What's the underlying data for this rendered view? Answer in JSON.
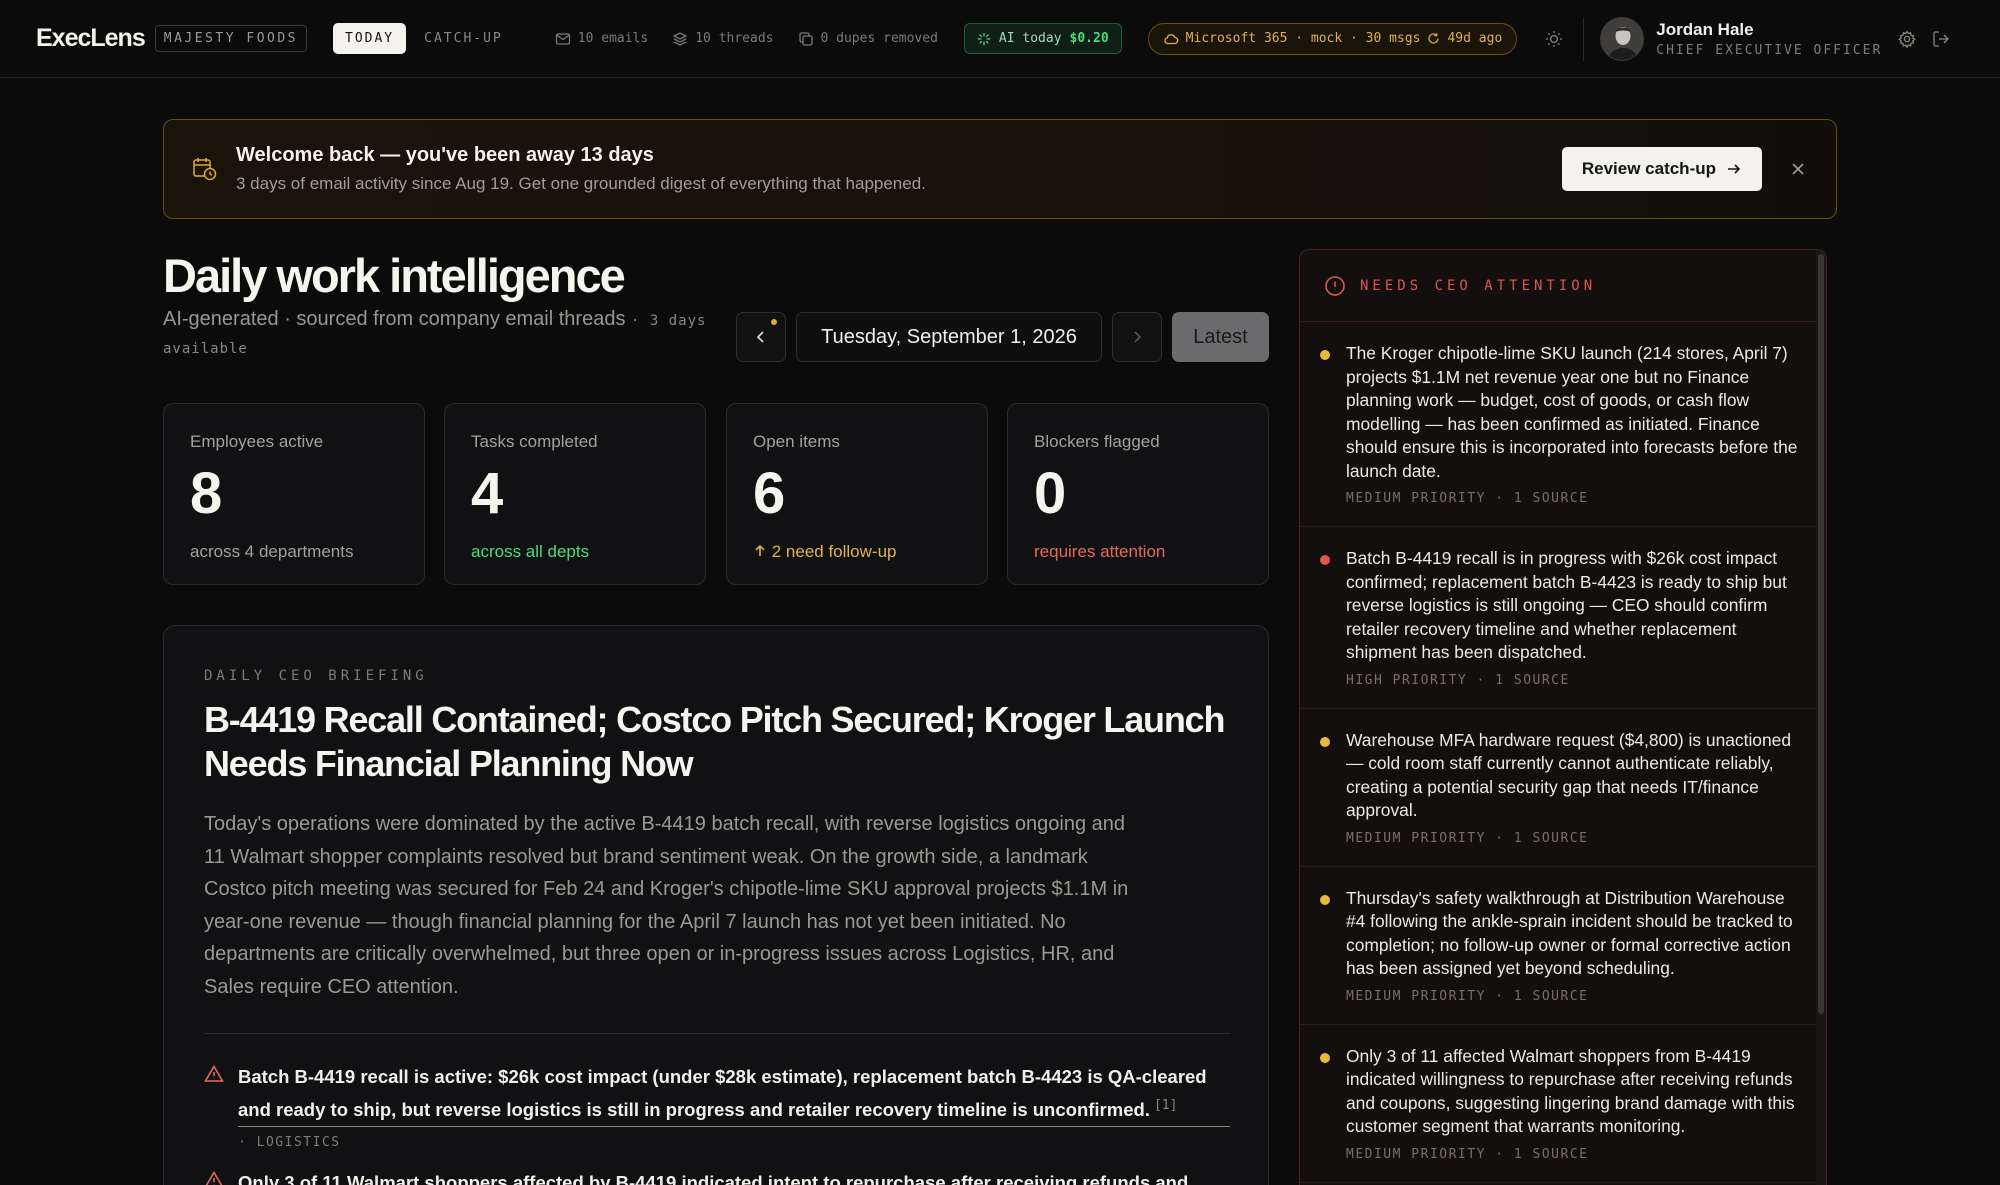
{
  "app": {
    "logo": "ExecLens",
    "company": "MAJESTY FOODS",
    "tabs": [
      "TODAY",
      "CATCH-UP"
    ],
    "stats": {
      "emails": "10 emails",
      "threads": "10 threads",
      "dupes": "0 dupes removed"
    },
    "ai": {
      "label": "AI today",
      "amount": "$0.20"
    },
    "connector": {
      "text": "Microsoft 365 · mock · 30 msgs",
      "sync": "49d ago"
    },
    "user": {
      "name": "Jordan Hale",
      "role": "CHIEF EXECUTIVE OFFICER"
    },
    "icons": [
      "mail-icon",
      "layers-icon",
      "copy-icon",
      "sparkle-icon",
      "cloud-icon",
      "refresh-icon",
      "sun-icon",
      "gear-icon",
      "logout-icon"
    ]
  },
  "banner": {
    "title": "Welcome back — you've been away 13 days",
    "subtitle": "3 days of email activity since Aug 19. Get one grounded digest of everything that happened.",
    "button": "Review catch-up"
  },
  "page": {
    "title": "Daily work intelligence",
    "subtitle": "AI-generated · sourced from company email threads",
    "days_available": "· 3 days available",
    "date": "Tuesday, September 1, 2026",
    "latest": "Latest"
  },
  "cards": [
    {
      "label": "Employees active",
      "value": "8",
      "foot": "across 4 departments"
    },
    {
      "label": "Tasks completed",
      "value": "4",
      "foot": "across all depts"
    },
    {
      "label": "Open items",
      "value": "6",
      "foot": "2 need follow-up"
    },
    {
      "label": "Blockers flagged",
      "value": "0",
      "foot": "requires attention"
    }
  ],
  "briefing": {
    "eyebrow": "DAILY CEO BRIEFING",
    "title": "B-4419 Recall Contained; Costco Pitch Secured; Kroger Launch Needs Financial Planning Now",
    "body": "Today's operations were dominated by the active B-4419 batch recall, with reverse logistics ongoing and 11 Walmart shopper complaints resolved but brand sentiment weak. On the growth side, a landmark Costco pitch meeting was secured for Feb 24 and Kroger's chipotle-lime SKU approval projects $1.1M in year-one revenue — though financial planning for the April 7 launch has not yet been initiated. No departments are critically overwhelmed, but three open or in-progress issues across Logistics, HR, and Sales require CEO attention.",
    "issues": [
      {
        "text": "Batch B-4419 recall is active: $26k cost impact (under $28k estimate), replacement batch B-4423 is QA-cleared and ready to ship, but reverse logistics is still in progress and retailer recovery timeline is unconfirmed.",
        "cite": "[1]",
        "tag": "· LOGISTICS"
      },
      {
        "text": "Only 3 of 11 Walmart shoppers affected by B-4419 indicated intent to repurchase after receiving refunds and",
        "cite": "",
        "tag": ""
      }
    ]
  },
  "attention": {
    "title": "NEEDS CEO ATTENTION",
    "colors": {
      "medium": "#e8b93a",
      "high": "#e0574a"
    },
    "items": [
      {
        "priority": "medium",
        "text": "The Kroger chipotle-lime SKU launch (214 stores, April 7) projects $1.1M net revenue year one but no Finance planning work — budget, cost of goods, or cash flow modelling — has been confirmed as initiated. Finance should ensure this is incorporated into forecasts before the launch date.",
        "meta": "MEDIUM PRIORITY · 1 SOURCE"
      },
      {
        "priority": "high",
        "text": "Batch B-4419 recall is in progress with $26k cost impact confirmed; replacement batch B-4423 is ready to ship but reverse logistics is still ongoing — CEO should confirm retailer recovery timeline and whether replacement shipment has been dispatched.",
        "meta": "HIGH PRIORITY · 1 SOURCE"
      },
      {
        "priority": "medium",
        "text": "Warehouse MFA hardware request ($4,800) is unactioned — cold room staff currently cannot authenticate reliably, creating a potential security gap that needs IT/finance approval.",
        "meta": "MEDIUM PRIORITY · 1 SOURCE"
      },
      {
        "priority": "medium",
        "text": "Thursday's safety walkthrough at Distribution Warehouse #4 following the ankle-sprain incident should be tracked to completion; no follow-up owner or formal corrective action has been assigned yet beyond scheduling.",
        "meta": "MEDIUM PRIORITY · 1 SOURCE"
      },
      {
        "priority": "medium",
        "text": "Only 3 of 11 affected Walmart shoppers from B-4419 indicated willingness to repurchase after receiving refunds and coupons, suggesting lingering brand damage with this customer segment that warrants monitoring.",
        "meta": "MEDIUM PRIORITY · 1 SOURCE"
      }
    ]
  }
}
